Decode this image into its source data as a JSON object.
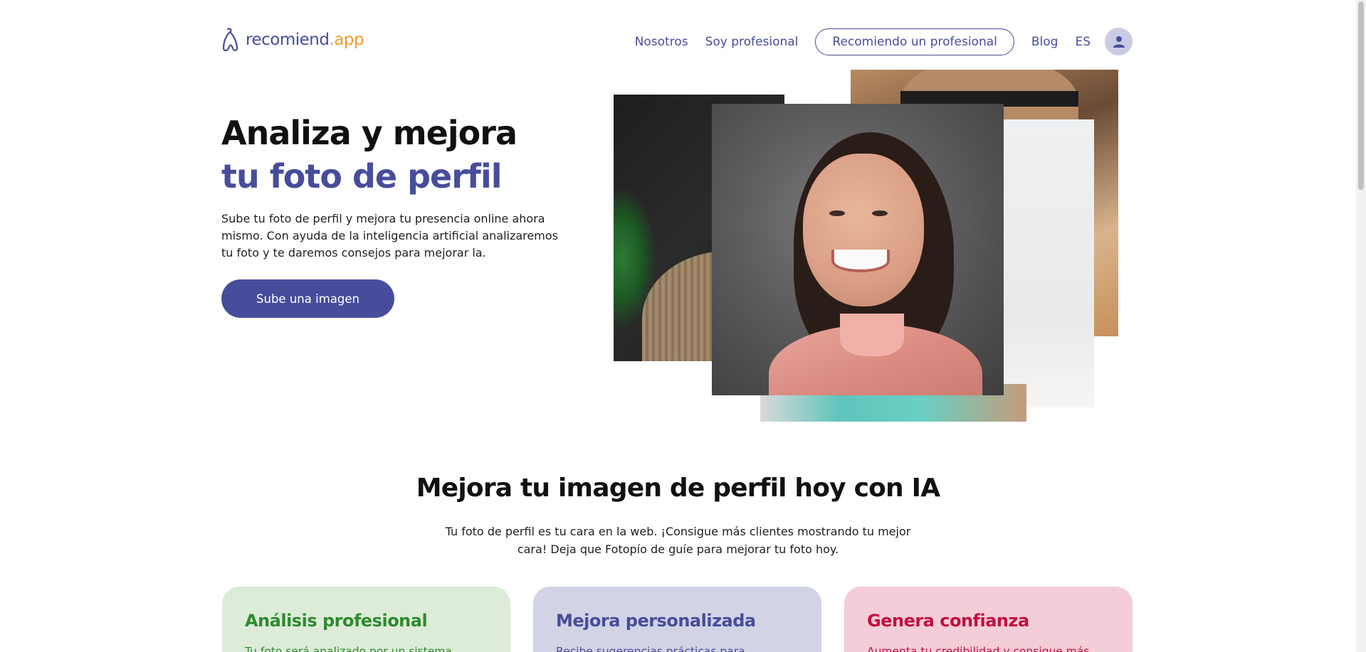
{
  "header": {
    "logo": {
      "part1": "recomiend",
      "part2": ".app"
    },
    "nav": {
      "about": "Nosotros",
      "professional": "Soy profesional",
      "recommend": "Recomiendo un profesional",
      "blog": "Blog",
      "language": "ES"
    }
  },
  "hero": {
    "title_line1": "Analiza y mejora",
    "title_line2": "tu foto de perfil",
    "description": "Sube tu foto de perfil y mejora tu presencia online ahora mismo. Con ayuda de la inteligencia artificial analizaremos tu foto y te daremos consejos para mejorar la.",
    "cta": "Sube una imagen"
  },
  "section": {
    "title": "Mejora tu imagen de perfil hoy con IA",
    "description": "Tu foto de perfil es tu cara en la web. ¡Consigue más clientes mostrando tu mejor cara! Deja que Fotopío de guíe para mejorar tu foto hoy."
  },
  "cards": [
    {
      "title": "Análisis profesional",
      "text": "Tu foto será analizado por un sistema",
      "color": "#2e8b2f"
    },
    {
      "title": "Mejora personalizada",
      "text": "Recibe sugerencias prácticas para",
      "color": "#474d9b"
    },
    {
      "title": "Genera confianza",
      "text": "Aumenta tu credibilidad y consigue más",
      "color": "#c2103f"
    }
  ],
  "colors": {
    "brand": "#474d9b",
    "accent": "#f29a2e"
  },
  "icons": {
    "avatar": "user-icon",
    "logo": "logo-mark-icon"
  }
}
